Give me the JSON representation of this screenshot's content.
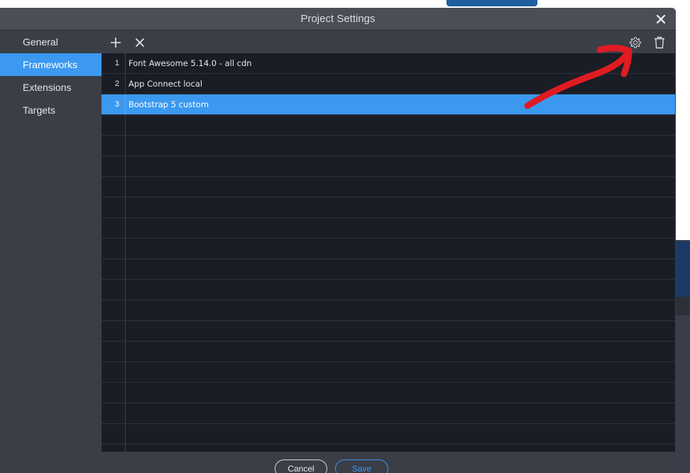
{
  "dialog": {
    "title": "Project Settings",
    "close_icon": "close-icon"
  },
  "sidebar": {
    "items": [
      {
        "label": "General",
        "active": false
      },
      {
        "label": "Frameworks",
        "active": true
      },
      {
        "label": "Extensions",
        "active": false
      },
      {
        "label": "Targets",
        "active": false
      }
    ]
  },
  "toolbar": {
    "add_icon": "plus-icon",
    "remove_icon": "close-icon",
    "settings_icon": "gear-icon",
    "delete_icon": "trash-icon"
  },
  "frameworks": {
    "rows": [
      {
        "num": "1",
        "name": "Font Awesome 5.14.0 - all cdn",
        "selected": false
      },
      {
        "num": "2",
        "name": "App Connect local",
        "selected": false
      },
      {
        "num": "3",
        "name": "Bootstrap 5 custom",
        "selected": true
      }
    ]
  },
  "footer": {
    "cancel_label": "Cancel",
    "save_label": "Save"
  },
  "colors": {
    "accent": "#3b99f0",
    "panel": "#3a3e47",
    "table_bg": "#1b1d26",
    "annotation": "#e01b22"
  }
}
